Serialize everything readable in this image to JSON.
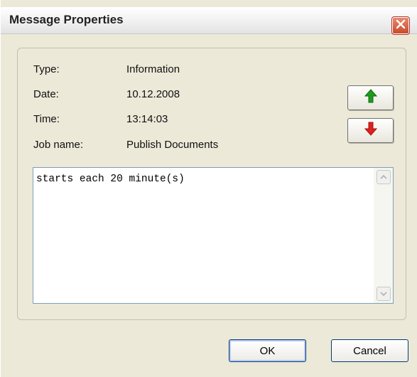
{
  "window": {
    "title": "Message Properties",
    "close_icon": "close-x-icon"
  },
  "fields": [
    {
      "label": "Type:",
      "value": "Information"
    },
    {
      "label": "Date:",
      "value": "10.12.2008"
    },
    {
      "label": "Time:",
      "value": "13:14:03"
    },
    {
      "label": "Job name:",
      "value": "Publish Documents"
    }
  ],
  "nav": {
    "up_icon": "green-arrow-up-icon",
    "down_icon": "red-arrow-down-icon",
    "up_color": "#1e9b1e",
    "down_color": "#e02020"
  },
  "message": {
    "text": "starts each 20 minute(s)"
  },
  "buttons": {
    "ok_label": "OK",
    "cancel_label": "Cancel"
  },
  "colors": {
    "background": "#ece9d8",
    "close_button": "#c94a2a",
    "text_border": "#7f9db9"
  }
}
